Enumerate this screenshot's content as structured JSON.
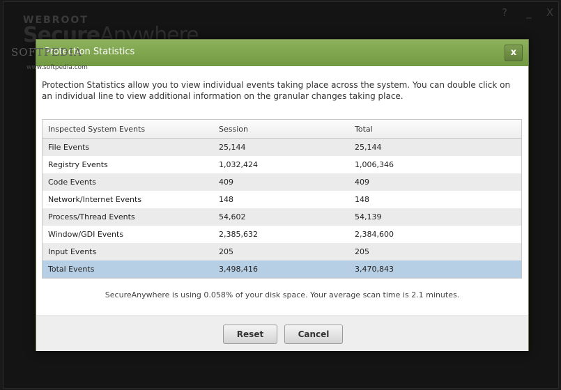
{
  "background_app": {
    "brand_small": "WEBROOT",
    "brand_bold": "Secure",
    "brand_thin": "Anywhere",
    "watermark": "SOFTPEDIA",
    "watermark_url": "www.softpedia.com",
    "controls": {
      "help": "?",
      "minimize": "_",
      "close": "X"
    }
  },
  "dialog": {
    "title": "Protection Statistics",
    "close_label": "x",
    "description": "Protection Statistics allow you to view individual events taking place across the system. You can double click on an individual line to view additional information on the granular changes taking place.",
    "table": {
      "headers": [
        "Inspected System Events",
        "Session",
        "Total"
      ],
      "rows": [
        [
          "File Events",
          "25,144",
          "25,144"
        ],
        [
          "Registry Events",
          "1,032,424",
          "1,006,346"
        ],
        [
          "Code Events",
          "409",
          "409"
        ],
        [
          "Network/Internet Events",
          "148",
          "148"
        ],
        [
          "Process/Thread Events",
          "54,602",
          "54,139"
        ],
        [
          "Window/GDI Events",
          "2,385,632",
          "2,384,600"
        ],
        [
          "Input Events",
          "205",
          "205"
        ],
        [
          "Total Events",
          "3,498,416",
          "3,470,843"
        ]
      ]
    },
    "footer_note": "SecureAnywhere is using 0.058% of your disk space. Your average scan time is  2.1 minutes.",
    "buttons": {
      "reset": "Reset",
      "cancel": "Cancel"
    }
  },
  "colors": {
    "title_bar": "#7fa74e",
    "selected_row": "#b7cfe4",
    "alt_row": "#ebebeb"
  }
}
